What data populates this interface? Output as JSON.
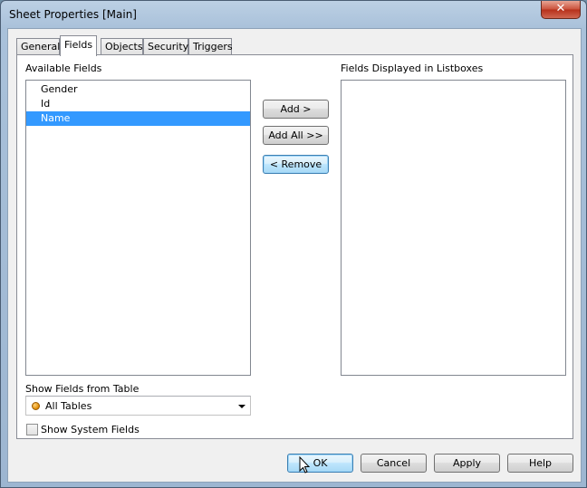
{
  "window": {
    "title": "Sheet Properties [Main]",
    "close_glyph": "✕"
  },
  "tabs": [
    {
      "label": "General"
    },
    {
      "label": "Fields"
    },
    {
      "label": "Objects"
    },
    {
      "label": "Security"
    },
    {
      "label": "Triggers"
    }
  ],
  "active_tab": "Fields",
  "available_fields": {
    "label": "Available Fields",
    "items": [
      "Gender",
      "Id",
      "Name"
    ],
    "selected": "Name"
  },
  "displayed_fields": {
    "label": "Fields Displayed in Listboxes",
    "items": []
  },
  "transfer_buttons": {
    "add": "Add >",
    "add_all": "Add All >>",
    "remove": "< Remove"
  },
  "show_fields_from_table": {
    "label": "Show Fields from Table",
    "value": "All Tables"
  },
  "show_system_fields": {
    "label": "Show System Fields",
    "checked": false
  },
  "footer_buttons": {
    "ok": "OK",
    "cancel": "Cancel",
    "apply": "Apply",
    "help": "Help"
  },
  "colors": {
    "selection": "#3399ff",
    "close_button": "#c9503a",
    "title_bar": "#a9c1da"
  },
  "icons": {
    "close": "close-icon",
    "table_dot": "table-dot-icon",
    "dropdown": "chevron-down-icon",
    "mouse_cursor": "mouse-pointer-icon"
  }
}
